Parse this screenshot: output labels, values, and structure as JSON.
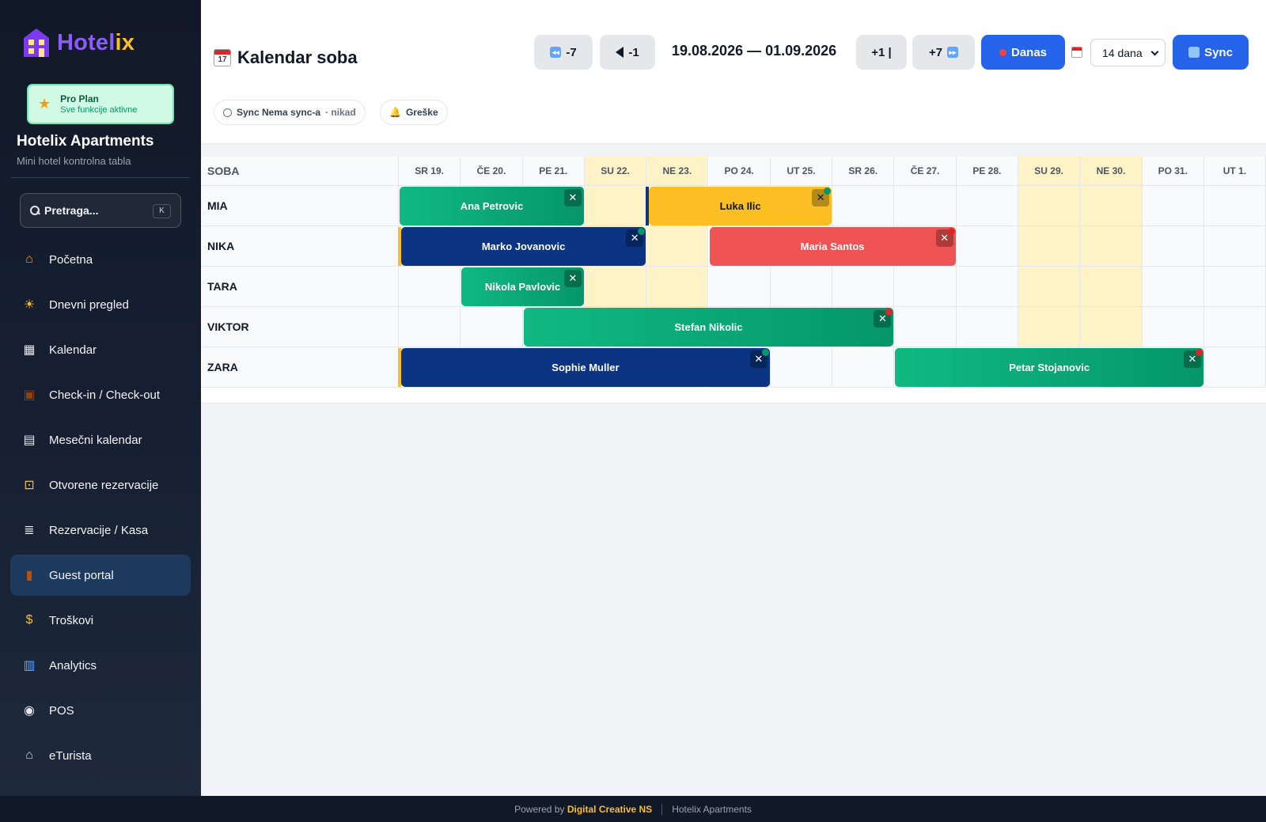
{
  "app": {
    "name_main": "Hotel",
    "name_accent": "ix",
    "plan_title": "Pro Plan",
    "plan_sub": "Sve funkcije aktivne",
    "hotel_name": "Hotelix Apartments",
    "hotel_sub": "Mini hotel kontrolna tabla"
  },
  "search": {
    "placeholder": "Pretraga...",
    "shortcut": "K"
  },
  "nav": [
    {
      "label": "Početna",
      "icon": "home-icon"
    },
    {
      "label": "Dnevni pregled",
      "icon": "sun-icon"
    },
    {
      "label": "Kalendar",
      "icon": "calendar-icon"
    },
    {
      "label": "Check-in / Check-out",
      "icon": "luggage-icon"
    },
    {
      "label": "Mesečni kalendar",
      "icon": "calendar-page-icon"
    },
    {
      "label": "Otvorene rezervacije",
      "icon": "lock-icon"
    },
    {
      "label": "Rezervacije / Kasa",
      "icon": "receipt-icon"
    },
    {
      "label": "Guest portal",
      "icon": "door-icon",
      "active": true
    },
    {
      "label": "Troškovi",
      "icon": "money-bag-icon"
    },
    {
      "label": "Analytics",
      "icon": "bar-chart-icon"
    },
    {
      "label": "POS",
      "icon": "plate-icon"
    },
    {
      "label": "eTurista",
      "icon": "bank-icon"
    }
  ],
  "header": {
    "title": "Kalendar soba",
    "btn_back7": "-7",
    "btn_back1": "-1",
    "date_range": "19.08.2026 — 01.09.2026",
    "btn_fwd1": "+1 |",
    "btn_fwd7": "+7",
    "btn_today": "Danas",
    "period": "14 dana",
    "btn_sync": "Sync",
    "sync_label": "Sync Nema sync-a",
    "sync_when": "· nikad",
    "errors_label": "Greške"
  },
  "grid": {
    "room_header": "SOBA",
    "days": [
      {
        "label": "SR 19.",
        "weekend": false
      },
      {
        "label": "ČE 20.",
        "weekend": false
      },
      {
        "label": "PE 21.",
        "weekend": false
      },
      {
        "label": "SU 22.",
        "weekend": true
      },
      {
        "label": "NE 23.",
        "weekend": true
      },
      {
        "label": "PO 24.",
        "weekend": false
      },
      {
        "label": "UT 25.",
        "weekend": false
      },
      {
        "label": "SR 26.",
        "weekend": false
      },
      {
        "label": "ČE 27.",
        "weekend": false
      },
      {
        "label": "PE 28.",
        "weekend": false
      },
      {
        "label": "SU 29.",
        "weekend": true
      },
      {
        "label": "NE 30.",
        "weekend": true
      },
      {
        "label": "PO 31.",
        "weekend": false
      },
      {
        "label": "UT 1.",
        "weekend": false
      }
    ],
    "rooms": [
      "MIA",
      "NIKA",
      "TARA",
      "VIKTOR",
      "ZARA"
    ],
    "bookings": [
      {
        "guest": "Ana Petrovic",
        "room": 0,
        "start": 0,
        "days": 3,
        "color": "green"
      },
      {
        "guest": "Luka Ilic",
        "room": 0,
        "start": 4,
        "days": 3,
        "color": "yellow",
        "dot": "#059669",
        "accent": "#0b3482"
      },
      {
        "guest": "Marko Jovanovic",
        "room": 1,
        "start": 0,
        "days": 4,
        "color": "navy",
        "dot": "#059669",
        "accent": "#fbbf24"
      },
      {
        "guest": "Maria Santos",
        "room": 1,
        "start": 5,
        "days": 4,
        "color": "red",
        "dot": "#dc2626"
      },
      {
        "guest": "Nikola Pavlovic",
        "room": 2,
        "start": 1,
        "days": 2,
        "color": "green"
      },
      {
        "guest": "Stefan Nikolic",
        "room": 3,
        "start": 2,
        "days": 6,
        "color": "green",
        "dot": "#dc2626"
      },
      {
        "guest": "Sophie Muller",
        "room": 4,
        "start": 0,
        "days": 6,
        "color": "navy",
        "dot": "#059669",
        "accent": "#fbbf24"
      },
      {
        "guest": "Petar Stojanovic",
        "room": 4,
        "start": 8,
        "days": 5,
        "color": "green",
        "dot": "#dc2626"
      }
    ]
  },
  "footer": {
    "powered": "Powered by",
    "brand": "Digital Creative NS",
    "hotel": "Hotelix Apartments"
  },
  "colors": {
    "primary": "#2563eb",
    "sidebar": "#111827",
    "accent": "#fbbf24",
    "booking_green": "#10b981",
    "booking_navy": "#0b3482",
    "booking_red": "#ef5354",
    "weekend": "#fef3c7"
  }
}
